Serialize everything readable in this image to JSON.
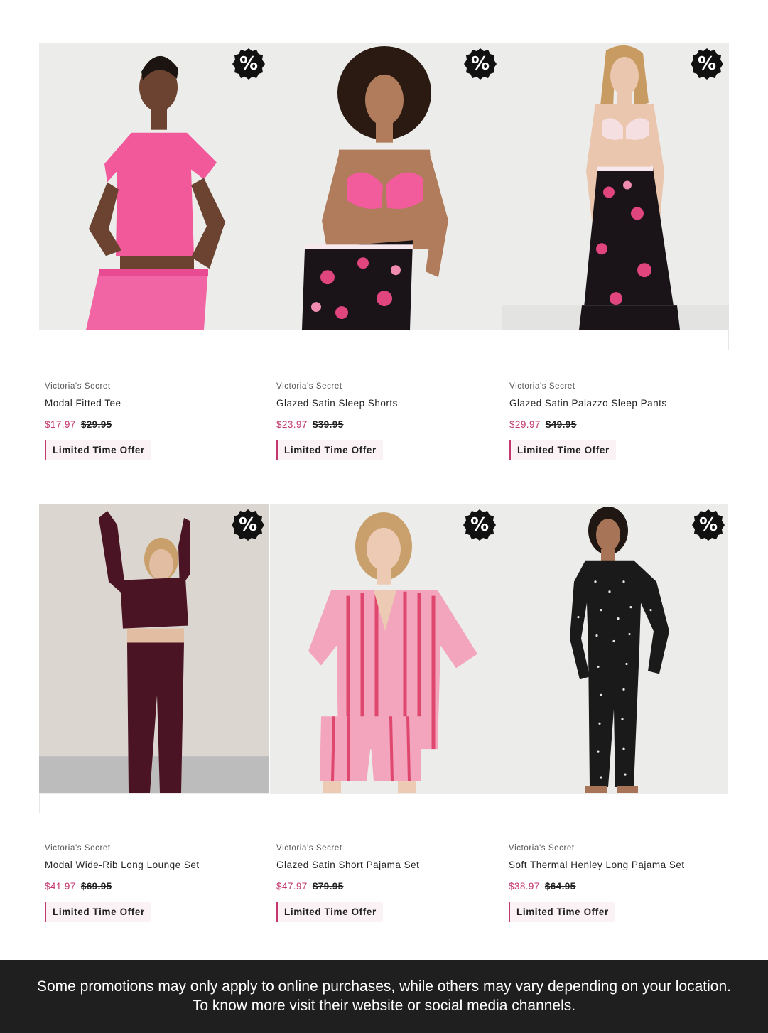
{
  "badge_text": "%",
  "colors": {
    "sale": "#c2386f",
    "offer_bg": "#fbf2f5",
    "footer_bg": "#1f1f1f",
    "badge": "#111111"
  },
  "products": [
    {
      "brand": "Victoria's Secret",
      "name": "Modal Fitted Tee",
      "sale_price": "$17.97",
      "original_price": "$29.95",
      "offer_label": "Limited Time Offer",
      "image_icon": "product-photo-pink-tee"
    },
    {
      "brand": "Victoria's Secret",
      "name": "Glazed Satin Sleep Shorts",
      "sale_price": "$23.97",
      "original_price": "$39.95",
      "offer_label": "Limited Time Offer",
      "image_icon": "product-photo-floral-shorts"
    },
    {
      "brand": "Victoria's Secret",
      "name": "Glazed Satin Palazzo Sleep Pants",
      "sale_price": "$29.97",
      "original_price": "$49.95",
      "offer_label": "Limited Time Offer",
      "image_icon": "product-photo-floral-pants"
    },
    {
      "brand": "Victoria's Secret",
      "name": "Modal Wide-Rib Long Lounge Set",
      "sale_price": "$41.97",
      "original_price": "$69.95",
      "offer_label": "Limited Time Offer",
      "image_icon": "product-photo-burgundy-lounge-set"
    },
    {
      "brand": "Victoria's Secret",
      "name": "Glazed Satin Short Pajama Set",
      "sale_price": "$47.97",
      "original_price": "$79.95",
      "offer_label": "Limited Time Offer",
      "image_icon": "product-photo-striped-pajama-set"
    },
    {
      "brand": "Victoria's Secret",
      "name": "Soft Thermal Henley Long Pajama Set",
      "sale_price": "$38.97",
      "original_price": "$64.95",
      "offer_label": "Limited Time Offer",
      "image_icon": "product-photo-black-henley-set"
    }
  ],
  "footer": {
    "line1": "Some promotions may only apply to online purchases, while others may vary depending on your location.",
    "line2": "To know more visit their website or social media channels."
  }
}
